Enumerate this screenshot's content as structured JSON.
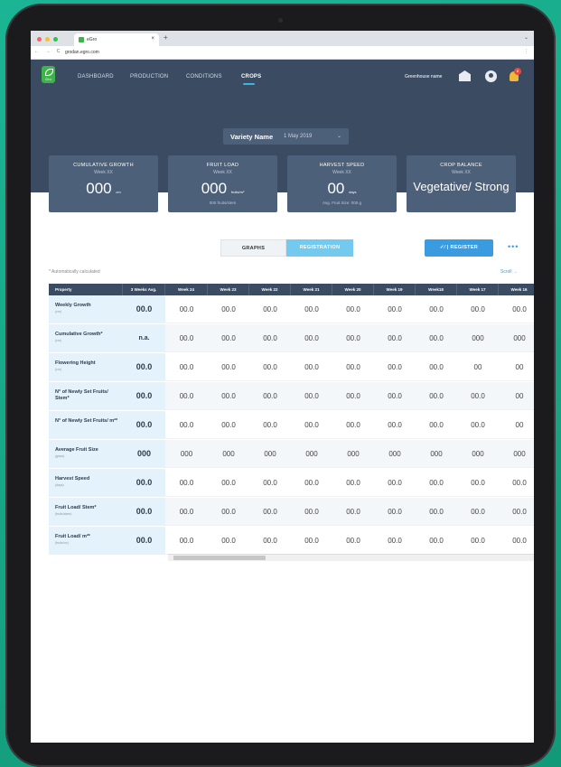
{
  "browser": {
    "tab_title": "eGro",
    "close": "×",
    "new_tab": "+",
    "nav_buttons": "← → C",
    "url": "grodan.egro.com",
    "menu": "⋮",
    "chevron": "⌄"
  },
  "app": {
    "logo_text": "Gro",
    "nav": [
      "DASHBOARD",
      "PRODUCTION",
      "CONDITIONS",
      "CROPS"
    ],
    "active_nav": "CROPS",
    "greenhouse_name": "Greenhouse name",
    "notification_count": "8",
    "variety": {
      "name": "Variety Name",
      "date": "1 May 2019",
      "chevron": "⌄"
    }
  },
  "kpis": [
    {
      "title": "CUMULATIVE GROWTH",
      "week": "Week XX",
      "value": "000",
      "unit": "cm",
      "sub": ""
    },
    {
      "title": "FRUIT LOAD",
      "week": "Week XX",
      "value": "000",
      "unit": "fruits/m²",
      "sub": "000 fruits/stem"
    },
    {
      "title": "HARVEST SPEED",
      "week": "Week XX",
      "value": "00",
      "unit": "days",
      "sub": "Avg. Fruit Size: 000 g"
    },
    {
      "title": "CROP BALANCE",
      "week": "Week XX",
      "value": "Vegetative/ Strong",
      "unit": "",
      "sub": ""
    }
  ],
  "toolbar": {
    "graphs": "GRAPHS",
    "registration": "REGISTRATION",
    "register": "REGISTER",
    "register_icon": "✓⁄ |",
    "more": "•••",
    "auto_note": "* Automatically calculated",
    "scroll": "Scroll →"
  },
  "table": {
    "headers": [
      "Property",
      "3 Weeks Avg.",
      "Week 24",
      "Week 23",
      "Week 22",
      "Week 21",
      "Week 20",
      "Week 19",
      "Week18",
      "Week 17",
      "Week 16"
    ],
    "rows": [
      {
        "label": "Weekly Growth",
        "unit": "(cm)",
        "avg": "00.0",
        "values": [
          "00.0",
          "00.0",
          "00.0",
          "00.0",
          "00.0",
          "00.0",
          "00.0",
          "00.0",
          "00.0"
        ]
      },
      {
        "label": "Cumulative Growth*",
        "unit": "(cm)",
        "avg": "n.a.",
        "values": [
          "00.0",
          "00.0",
          "00.0",
          "00.0",
          "00.0",
          "00.0",
          "00.0",
          "000",
          "000"
        ]
      },
      {
        "label": "Flowering Height",
        "unit": "(cm)",
        "avg": "00.0",
        "values": [
          "00.0",
          "00.0",
          "00.0",
          "00.0",
          "00.0",
          "00.0",
          "00.0",
          "00",
          "00"
        ]
      },
      {
        "label": "N° of Newly Set Fruits/ Stem*",
        "unit": "",
        "avg": "00.0",
        "values": [
          "00.0",
          "00.0",
          "00.0",
          "00.0",
          "00.0",
          "00.0",
          "00.0",
          "00.0",
          "00"
        ]
      },
      {
        "label": "N° of Newly Set Fruits/ m²*",
        "unit": "",
        "avg": "00.0",
        "values": [
          "00.0",
          "00.0",
          "00.0",
          "00.0",
          "00.0",
          "00.0",
          "00.0",
          "00.0",
          "00"
        ]
      },
      {
        "label": "Average Fruit Size",
        "unit": "(gram)",
        "avg": "000",
        "values": [
          "000",
          "000",
          "000",
          "000",
          "000",
          "000",
          "000",
          "000",
          "000"
        ]
      },
      {
        "label": "Harvest Speed",
        "unit": "(days)",
        "avg": "00.0",
        "values": [
          "00.0",
          "00.0",
          "00.0",
          "00.0",
          "00.0",
          "00.0",
          "00.0",
          "00.0",
          "00.0"
        ]
      },
      {
        "label": "Fruit Load/ Stem*",
        "unit": "(fruits/stem)",
        "avg": "00.0",
        "values": [
          "00.0",
          "00.0",
          "00.0",
          "00.0",
          "00.0",
          "00.0",
          "00.0",
          "00.0",
          "00.0"
        ]
      },
      {
        "label": "Fruit Load/ m²*",
        "unit": "(fruits/m²)",
        "avg": "00.0",
        "values": [
          "00.0",
          "00.0",
          "00.0",
          "00.0",
          "00.0",
          "00.0",
          "00.0",
          "00.0",
          "00.0"
        ]
      }
    ]
  },
  "colors": {
    "header_bg": "#3a4b62",
    "kpi_bg": "#4d6079",
    "accent_blue": "#3b9be0",
    "logo_green": "#3db34a",
    "background_green": "#17a889"
  }
}
